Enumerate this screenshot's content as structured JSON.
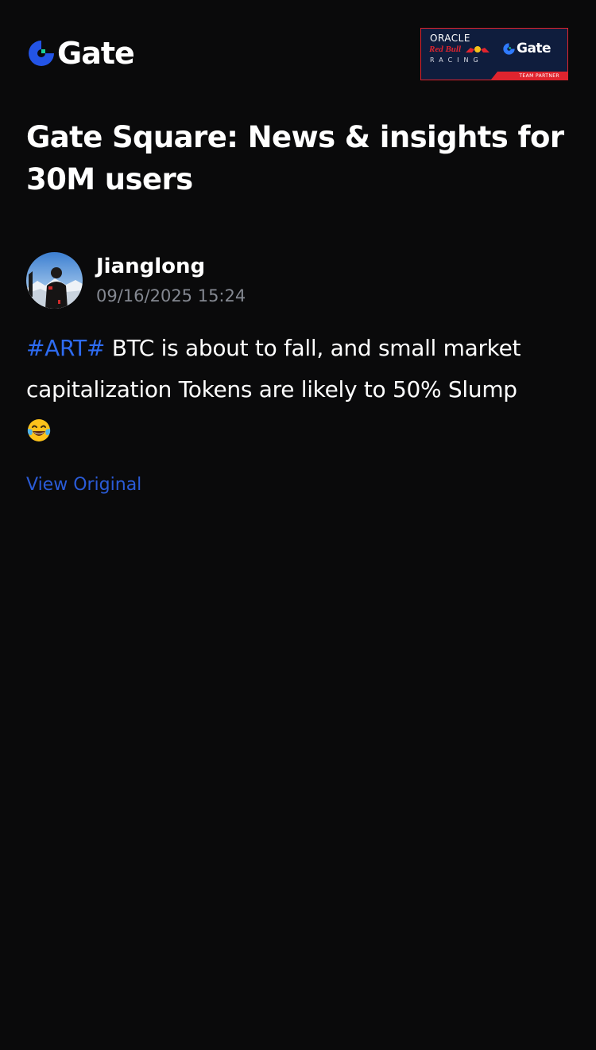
{
  "header": {
    "logo_text": "Gate",
    "partner": {
      "oracle": "ORACLE",
      "redbull": "Red Bull",
      "racing": "RACING",
      "brand": "Gate",
      "badge": "TEAM PARTNER"
    }
  },
  "page": {
    "title": "Gate Square: News & insights for 30M users"
  },
  "post": {
    "author": "Jianglong",
    "timestamp": "09/16/2025 15:24",
    "hashtag": "#ART#",
    "text": " BTC is about to fall, and small market capitalization Tokens are likely to 50% Slump ",
    "emoji": "😂",
    "view_original": "View Original"
  },
  "colors": {
    "background": "#0a0a0b",
    "accent_blue": "#2e6bf0",
    "link_blue": "#2a5bd7",
    "muted_text": "#848891",
    "partner_red": "#e0242e",
    "partner_navy": "#0f1d3d"
  }
}
